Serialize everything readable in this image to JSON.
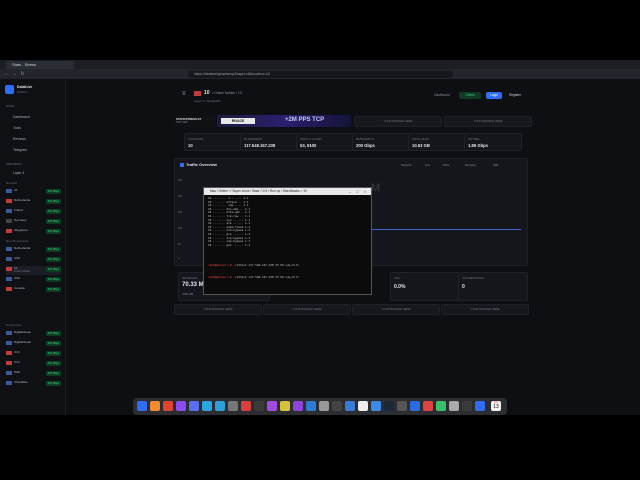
{
  "browser": {
    "tab_title": "Stats - Stress",
    "url": "https://dstatcet/graphs/vp3/layer=4&location=10",
    "nav_back": "←",
    "nav_forward": "→",
    "nav_reload": "↻"
  },
  "sidebar": {
    "brand": "DstatLive",
    "brand_sub": "Mobile",
    "section_main": "MAIN",
    "items": [
      {
        "label": "Dashboard"
      },
      {
        "label": "Tools"
      },
      {
        "label": "Reviews"
      },
      {
        "label": "Telegram"
      }
    ],
    "section_servers": "SERVERS",
    "layer_label": "Layer 4",
    "group_heading": "Normal",
    "servers": [
      {
        "name": "10",
        "sub": "",
        "status": "500 Mbps"
      },
      {
        "name": "Netherlands",
        "sub": "",
        "status": "500 Mbps"
      },
      {
        "name": "France",
        "sub": "",
        "status": "500 Mbps"
      },
      {
        "name": "Germany",
        "sub": "",
        "status": "500 Mbps"
      },
      {
        "name": "Singapore",
        "sub": "",
        "status": "500 Mbps"
      }
    ],
    "group2_heading": "Non-Protected",
    "servers2": [
      {
        "name": "Netherlands",
        "sub": "",
        "status": "500 Mbps"
      },
      {
        "name": "USA",
        "sub": "",
        "status": "500 Mbps"
      },
      {
        "name": "10",
        "sub": "Online Mobile",
        "status": "500 Mbps"
      },
      {
        "name": "USA",
        "sub": "",
        "status": "500 Mbps"
      },
      {
        "name": "Canada",
        "sub": "",
        "status": "500 Mbps"
      }
    ],
    "group3_heading": "Protection",
    "servers3": [
      {
        "name": "DigitalOcean",
        "sub": "",
        "status": "500 Mbps"
      },
      {
        "name": "DigitalOcean",
        "sub": "",
        "status": "500 Mbps"
      },
      {
        "name": "Ovh",
        "sub": "",
        "status": "500 Mbps"
      },
      {
        "name": "Ovh",
        "sub": "",
        "status": "500 Mbps"
      },
      {
        "name": "Path",
        "sub": "",
        "status": "500 Mbps"
      },
      {
        "name": "Cloudflare",
        "sub": "",
        "status": "500 Mbps"
      }
    ]
  },
  "header": {
    "server_number": "10",
    "server_sub": "• Online Mobile • 10",
    "breadcrumb": "Layer 4 • bandwidth",
    "dashboard_label": "Dashboard",
    "online_label": "Online",
    "login_label": "Login",
    "register_label": "Register"
  },
  "ad": {
    "left_title": "STATICSTRESS.ST",
    "left_sub": "TOP UDP",
    "brand": "RIVACE",
    "text": "+2M PPS TCP",
    "slot1": "YOUR BANNER HERE",
    "slot2": "YOUR BANNER HERE"
  },
  "stats": [
    {
      "label": "Location",
      "value": "10"
    },
    {
      "label": "IP Address",
      "value": "117.548.167.238"
    },
    {
      "label": "Port & Layer",
      "value": "53, 5100"
    },
    {
      "label": "Bandwidth",
      "value": "200 Gbps"
    },
    {
      "label": "Total Ram",
      "value": "10.53 GB"
    },
    {
      "label": "Uptime",
      "value": "1.86 Gbps"
    }
  ],
  "traffic": {
    "title": "Traffic Overview",
    "controls": [
      "Network",
      "Live",
      "Pairs",
      "Reciving",
      "Split"
    ],
    "yticks": [
      "25k",
      "20k",
      "15k",
      "10k",
      "5k",
      "0"
    ],
    "watermark": "M"
  },
  "bottom_stats": [
    {
      "label": "Received",
      "value": "70.33 M",
      "sub": "4.96 GB"
    },
    {
      "label": "CPU",
      "value": "0.0%",
      "sub": ""
    },
    {
      "label": "Connections",
      "value": "0",
      "sub": ""
    }
  ],
  "bottom_banners": [
    "YOUR BANNER HERE",
    "YOUR BANNER HERE",
    "YOUR BANNER HERE",
    "YOUR BANNER HERE"
  ],
  "terminal": {
    "title": "Mac / Online \\ / Super Linux / Stats 7.0.5 / Run up / Stat Attacks > 10",
    "rows": [
      "10 ........ 1 ...... 1.1",
      "10 ....... attack .. 1.1",
      "10 ........ udp .... 1.1",
      "10 ....... dns-amp .. 1.1",
      "10 ....... http-get . 1.1",
      "10 ....... tcp-raw .. 1.1",
      "10 ....... syn ...... 1.1",
      "10 ....... ack ...... 1.1",
      "10 ....... home-flood 1.1",
      "10 ....... ovh-bypass 1.1",
      "10 ....... gre ...... 1.1",
      "10 ....... tcp-bypass 1.1",
      "10 ....... udp-bypass 1.1",
      "10 ....... pps ...... 1.1"
    ],
    "prompt1": "root@server:~#",
    "cmd1": " ./attack 117.548.167.238 53 60 udp-bill",
    "prompt2": "root@server:~#",
    "cmd2": " ./attack 117.548.167.238 53 60 udp-bill"
  },
  "dock": {
    "date_month": "JUL",
    "date_day": "13"
  },
  "colors": {
    "accent": "#2f6df6",
    "online": "#1db954",
    "brand_ad": "#5a3cff"
  }
}
